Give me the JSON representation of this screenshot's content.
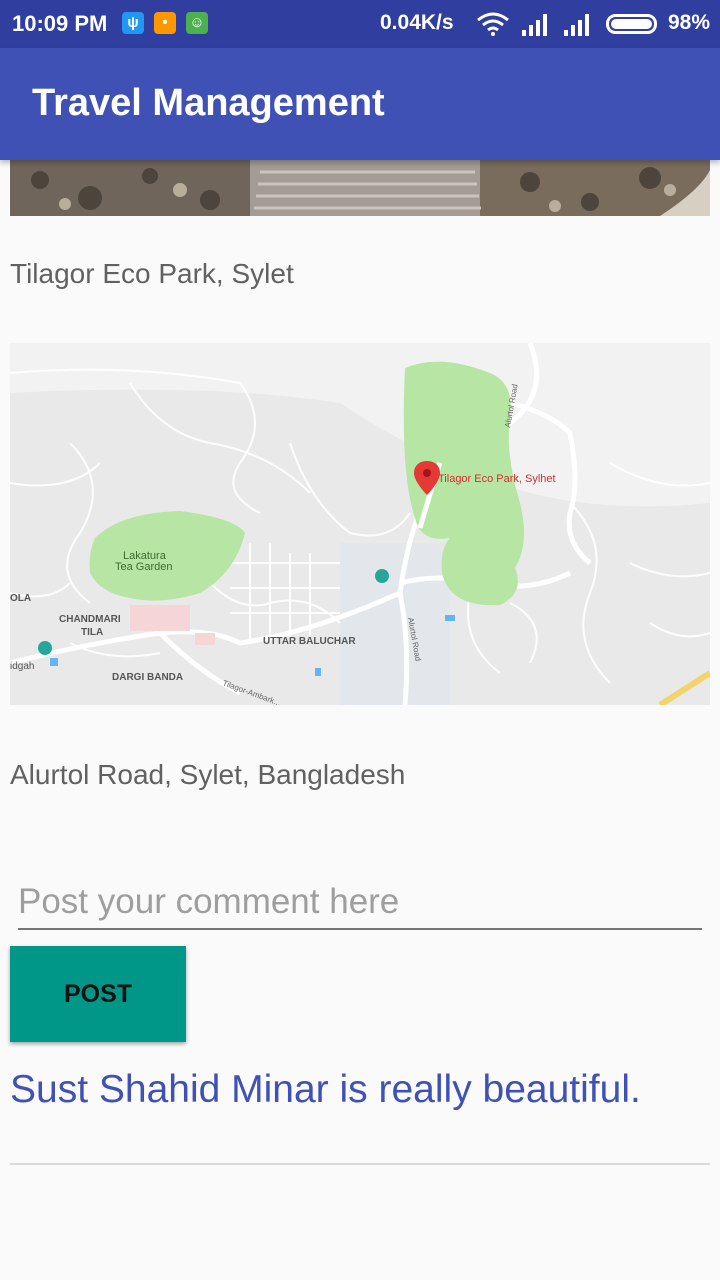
{
  "status_bar": {
    "time": "10:09 PM",
    "network_speed": "0.04K/s",
    "battery_percent": "98%",
    "notification_icons": [
      "usb-icon",
      "chat-icon",
      "android-icon"
    ]
  },
  "app_bar": {
    "title": "Travel Management"
  },
  "place": {
    "name": "Tilagor Eco Park, Sylet",
    "address": "Alurtol Road, Sylet, Bangladesh"
  },
  "map": {
    "marker_label": "Tilagor Eco Park, Sylhet",
    "labels": {
      "lakatura_1": "Lakatura",
      "lakatura_2": "Tea Garden",
      "ola": "OLA",
      "chandmari_1": "CHANDMARI",
      "chandmari_2": "TILA",
      "idgah": "idgah",
      "dargi_banda": "DARGI BANDA",
      "uttar_baluchar": "UTTAR BALUCHAR",
      "alurtol_road_top": "Alurtol Road",
      "alurtol_road_mid": "Alurtol Road",
      "tilagor_ambarkhana": "Tilagor-Ambark..."
    }
  },
  "comment_form": {
    "placeholder": "Post your comment here",
    "value": "",
    "post_label": "POST"
  },
  "comments": [
    {
      "text": "Sust Shahid Minar is really beautiful."
    }
  ],
  "colors": {
    "status_bar": "#303f9f",
    "app_bar": "#3f51b5",
    "post_button": "#009688",
    "comment_text": "#3f51b5",
    "park_green": "#b6e5a4",
    "marker_red": "#e53935"
  }
}
